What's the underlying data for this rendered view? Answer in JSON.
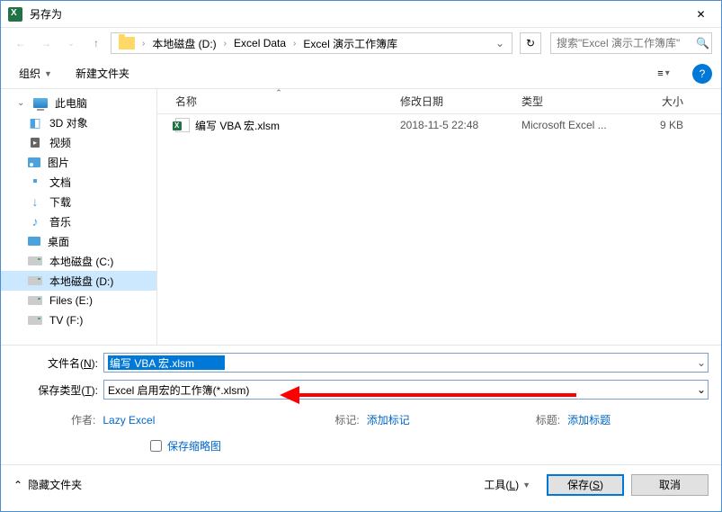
{
  "window": {
    "title": "另存为"
  },
  "nav": {
    "breadcrumb": [
      "本地磁盘 (D:)",
      "Excel Data",
      "Excel 演示工作簿库"
    ],
    "search_placeholder": "搜索\"Excel 演示工作簿库\""
  },
  "toolbar": {
    "organize": "组织",
    "new_folder": "新建文件夹"
  },
  "sidebar": {
    "items": [
      {
        "label": "此电脑",
        "icon": "pc",
        "expandable": true
      },
      {
        "label": "3D 对象",
        "icon": "3d",
        "child": true
      },
      {
        "label": "视频",
        "icon": "video",
        "child": true
      },
      {
        "label": "图片",
        "icon": "pic",
        "child": true
      },
      {
        "label": "文档",
        "icon": "doc",
        "child": true
      },
      {
        "label": "下载",
        "icon": "dl",
        "child": true
      },
      {
        "label": "音乐",
        "icon": "music",
        "child": true
      },
      {
        "label": "桌面",
        "icon": "desk",
        "child": true
      },
      {
        "label": "本地磁盘 (C:)",
        "icon": "drive",
        "child": true
      },
      {
        "label": "本地磁盘 (D:)",
        "icon": "drive",
        "child": true,
        "selected": true
      },
      {
        "label": "Files (E:)",
        "icon": "drive",
        "child": true
      },
      {
        "label": "TV (F:)",
        "icon": "drive",
        "child": true
      }
    ]
  },
  "columns": {
    "name": "名称",
    "date": "修改日期",
    "type": "类型",
    "size": "大小"
  },
  "files": [
    {
      "name": "编写 VBA 宏.xlsm",
      "date": "2018-11-5 22:48",
      "type": "Microsoft Excel ...",
      "size": "9 KB"
    }
  ],
  "form": {
    "filename_label": "文件名(N):",
    "filename_value": "编写 VBA 宏.xlsm",
    "filetype_label": "保存类型(T):",
    "filetype_value": "Excel 启用宏的工作簿(*.xlsm)",
    "author_label": "作者:",
    "author_value": "Lazy Excel",
    "tags_label": "标记:",
    "tags_value": "添加标记",
    "title_label": "标题:",
    "title_value": "添加标题",
    "thumbnail": "保存缩略图"
  },
  "footer": {
    "hide_folders": "隐藏文件夹",
    "tools": "工具(L)",
    "save": "保存(S)",
    "cancel": "取消"
  }
}
